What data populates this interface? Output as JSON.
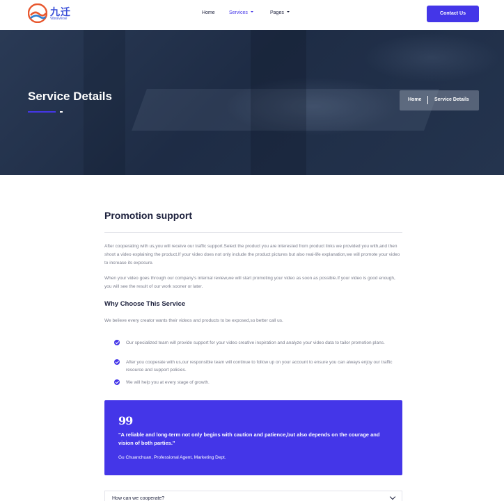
{
  "header": {
    "logo_cn": "九迁",
    "logo_en": "VibraVerse",
    "nav": {
      "home": "Home",
      "services": "Services",
      "pages": "Pages"
    },
    "contact_button": "Contact Us"
  },
  "hero": {
    "title": "Service Details",
    "breadcrumb": {
      "home": "Home",
      "current": "Service Details"
    }
  },
  "content": {
    "title": "Promotion support",
    "paragraph1": "After cooperating with us,you will receive our traffic support.Select the product you are interested from product links we provided you with,and then shoot a video explaining the product.If your video does not only include the product pictures but also real-life explanation,we will promote your video to increase its exposure.",
    "paragraph2": "When your video goes through our company's internal review,we will start promoting your video as soon as possible.If your video is good enough, you will see the result of our work sooner or later.",
    "why_title": "Why Choose This Service",
    "why_text": "We believe every creator wants their videos and products to be exposed,so better call us.",
    "checklist": [
      "Our specialized team will provide support for your video creative inspiration and analyze your video data to tailor promotion plans.",
      "After you cooperate with us,our responsible team will continue to follow up on your account to ensure you can always enjoy our traffic resource and support policies.",
      "We will help you at every stage of growth."
    ],
    "quote": {
      "mark": "99",
      "text": "\"A reliable and long-term not only begins with caution and patience,but also depends on the courage and vision of both parties.\"",
      "author": "Gu Chuanchuan, Professional Agent, Marketing Dept."
    },
    "faq": {
      "question": "How can we cooperate?"
    }
  },
  "colors": {
    "accent": "#4436e8",
    "hero_bg": "#1e2c45",
    "text_dark": "#1b1f3b",
    "text_muted": "#7a7d8c"
  }
}
